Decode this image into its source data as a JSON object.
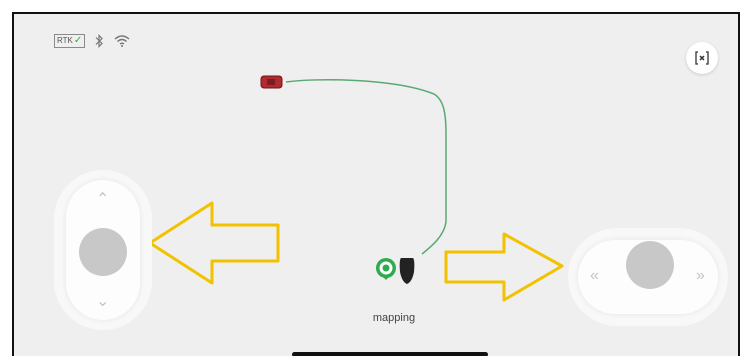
{
  "status_bar": {
    "rtk_label": "RTK",
    "rtk_check": "✓",
    "icons": [
      "rtk-status-icon",
      "bluetooth-icon",
      "wifi-icon"
    ]
  },
  "exit_button": {
    "icon": "exit-fullscreen-icon"
  },
  "joystick_vertical": {
    "up_icon": "double-chevron-up-icon",
    "down_icon": "double-chevron-down-icon",
    "up_glyph": "⌃",
    "down_glyph": "⌄"
  },
  "joystick_horizontal": {
    "left_glyph": "«",
    "right_glyph": "»"
  },
  "map": {
    "path_color": "#5aa872",
    "mower_color": "#b02a30",
    "marker_color": "#2eab4f",
    "arrow_color": "#f2c200"
  },
  "status_label": "mapping"
}
